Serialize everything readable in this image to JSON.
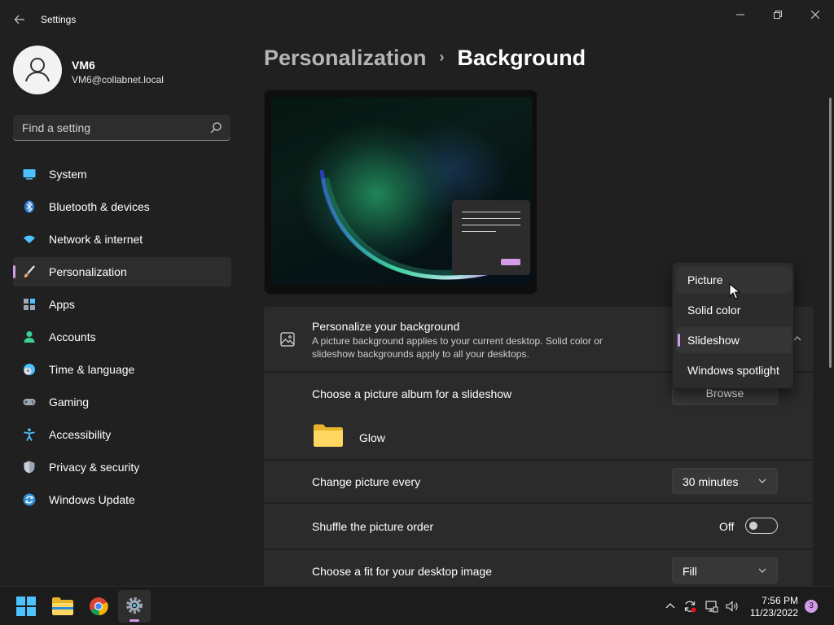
{
  "titlebar": {
    "title": "Settings",
    "back_icon": "back-arrow-icon",
    "minimize_icon": "minimize-icon",
    "maximize_icon": "restore-icon",
    "close_icon": "close-icon"
  },
  "user": {
    "name": "VM6",
    "email": "VM6@collabnet.local"
  },
  "search": {
    "placeholder": "Find a setting"
  },
  "sidebar": {
    "items": [
      {
        "label": "System",
        "icon": "system-icon",
        "color": "#4cc2ff"
      },
      {
        "label": "Bluetooth & devices",
        "icon": "bluetooth-icon",
        "color": "#4cc2ff"
      },
      {
        "label": "Network & internet",
        "icon": "wifi-icon",
        "color": "#4cc2ff"
      },
      {
        "label": "Personalization",
        "icon": "brush-icon",
        "color": "#e6a86b",
        "active": true
      },
      {
        "label": "Apps",
        "icon": "apps-icon",
        "color": "#9aa7b5"
      },
      {
        "label": "Accounts",
        "icon": "accounts-icon",
        "color": "#3ccf96"
      },
      {
        "label": "Time & language",
        "icon": "clock-globe-icon",
        "color": "#4cc2ff"
      },
      {
        "label": "Gaming",
        "icon": "gamepad-icon",
        "color": "#9aa7b5"
      },
      {
        "label": "Accessibility",
        "icon": "accessibility-icon",
        "color": "#4cc2ff"
      },
      {
        "label": "Privacy & security",
        "icon": "shield-icon",
        "color": "#9aa7b5"
      },
      {
        "label": "Windows Update",
        "icon": "update-icon",
        "color": "#4cc2ff"
      }
    ]
  },
  "breadcrumb": {
    "parent": "Personalization",
    "separator": "›",
    "current": "Background"
  },
  "background_card": {
    "title": "Personalize your background",
    "subtitle_line1": "A picture background applies to your current desktop. Solid color or",
    "subtitle_line2": "slideshow backgrounds apply to all your desktops."
  },
  "album": {
    "label": "Choose a picture album for a slideshow",
    "browse_label": "Browse",
    "folder_name": "Glow"
  },
  "change_picture": {
    "label": "Change picture every",
    "value": "30 minutes"
  },
  "shuffle": {
    "label": "Shuffle the picture order",
    "state_label": "Off",
    "on": false
  },
  "fit": {
    "label": "Choose a fit for your desktop image",
    "value": "Fill"
  },
  "dropdown": {
    "options": [
      "Picture",
      "Solid color",
      "Slideshow",
      "Windows spotlight"
    ],
    "selected": "Slideshow",
    "hovered": "Picture"
  },
  "taskbar": {
    "apps": [
      "start-icon",
      "file-explorer-icon",
      "chrome-icon",
      "settings-icon"
    ],
    "time": "7:56 PM",
    "date": "11/23/2022",
    "notification_count": "3"
  },
  "colors": {
    "accent": "#d39ce6",
    "background": "#202020",
    "card": "#2b2b2b"
  }
}
